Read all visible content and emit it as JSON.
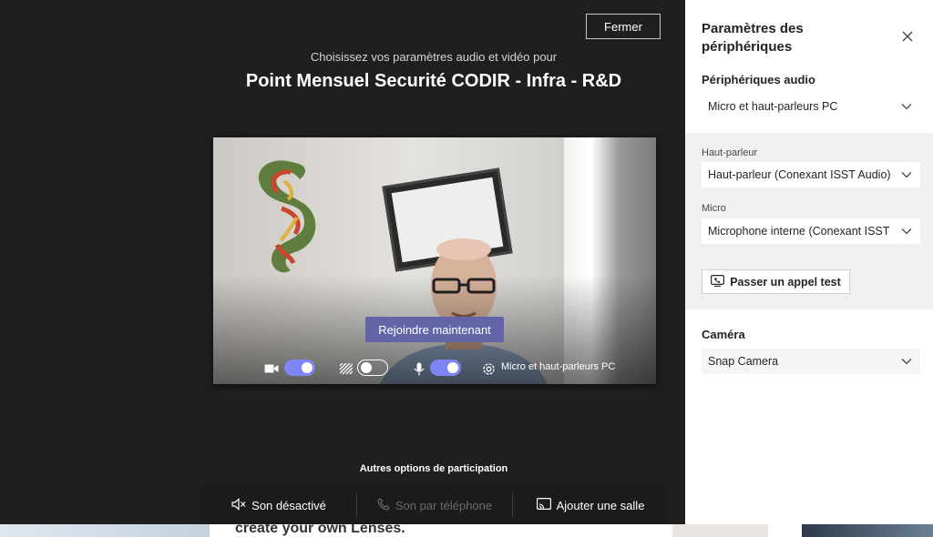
{
  "stage": {
    "close_label": "Fermer",
    "subtitle": "Choisissez vos paramètres audio et vidéo pour",
    "meeting_title": "Point Mensuel Securité CODIR - Infra - R&D",
    "join_label": "Rejoindre maintenant",
    "controls": {
      "camera_toggle": "on",
      "background_blur_toggle": "off",
      "mic_toggle": "on",
      "device_label": "Micro et haut-parleurs PC"
    },
    "other_options_title": "Autres options de participation",
    "options": [
      {
        "label": "Son désactivé",
        "icon": "speaker-off-icon",
        "enabled": true
      },
      {
        "label": "Son par téléphone",
        "icon": "phone-icon",
        "enabled": false
      },
      {
        "label": "Ajouter une salle",
        "icon": "cast-icon",
        "enabled": true
      }
    ]
  },
  "strip": {
    "text": "create your own Lenses."
  },
  "panel": {
    "title": "Paramètres des périphériques",
    "audio_section": "Périphériques audio",
    "audio_device": "Micro et haut-parleurs PC",
    "speaker_label": "Haut-parleur",
    "speaker_value": "Haut-parleur (Conexant ISST Audio)",
    "mic_label": "Micro",
    "mic_value": "Microphone interne (Conexant ISST ...",
    "test_call_label": "Passer un appel test",
    "camera_section": "Caméra",
    "camera_value": "Snap Camera"
  },
  "colors": {
    "accent": "#6264a7",
    "toggle_on": "#7f85f5",
    "background": "#1f1f1f",
    "panel_bg": "#f0f0f0"
  }
}
